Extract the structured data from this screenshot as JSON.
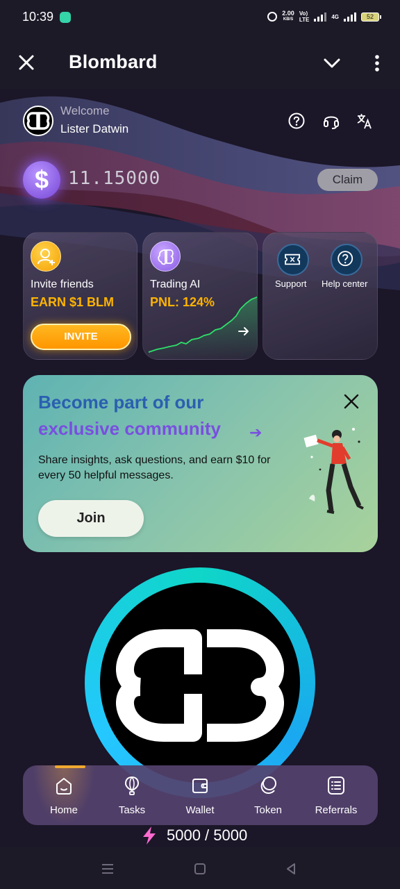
{
  "status_bar": {
    "time": "10:39",
    "speed_top": "2.00",
    "speed_unit": "KB/S",
    "volte_top": "Vo)",
    "volte_bottom": "LTE",
    "network": "4G",
    "battery": "52"
  },
  "app_bar": {
    "title": "Blombard",
    "icons": [
      "close-icon",
      "chevron-down-icon",
      "more-vertical-icon"
    ]
  },
  "header": {
    "welcome_label": "Welcome",
    "user_name": "Lister Datwin",
    "icons": [
      "help-icon",
      "headset-icon",
      "translate-icon"
    ]
  },
  "balance": {
    "currency_symbol": "$",
    "amount": "11.15000",
    "claim_label": "Claim"
  },
  "cards": {
    "invite": {
      "title": "Invite friends",
      "subtitle": "EARN $1 BLM",
      "button_label": "INVITE"
    },
    "trading": {
      "title": "Trading AI",
      "subtitle": "PNL: 124%"
    },
    "support": {
      "support_label": "Support",
      "help_label": "Help center"
    }
  },
  "banner": {
    "headline_line1": "Become part of our",
    "headline_line2": "exclusive community",
    "arrow": "➔",
    "body": "Share insights, ask questions, and earn $10 for every 50 helpful messages.",
    "join_label": "Join"
  },
  "bottom_nav": {
    "items": [
      {
        "label": "Home",
        "icon": "home-icon",
        "active": true
      },
      {
        "label": "Tasks",
        "icon": "balloon-icon",
        "active": false
      },
      {
        "label": "Wallet",
        "icon": "wallet-icon",
        "active": false
      },
      {
        "label": "Token",
        "icon": "token-icon",
        "active": false
      },
      {
        "label": "Referrals",
        "icon": "list-icon",
        "active": false
      }
    ]
  },
  "energy": {
    "value": "5000 / 5000"
  },
  "colors": {
    "accent_orange": "#ffb400",
    "accent_purple": "#7a4fe0",
    "background": "#1b1628"
  }
}
